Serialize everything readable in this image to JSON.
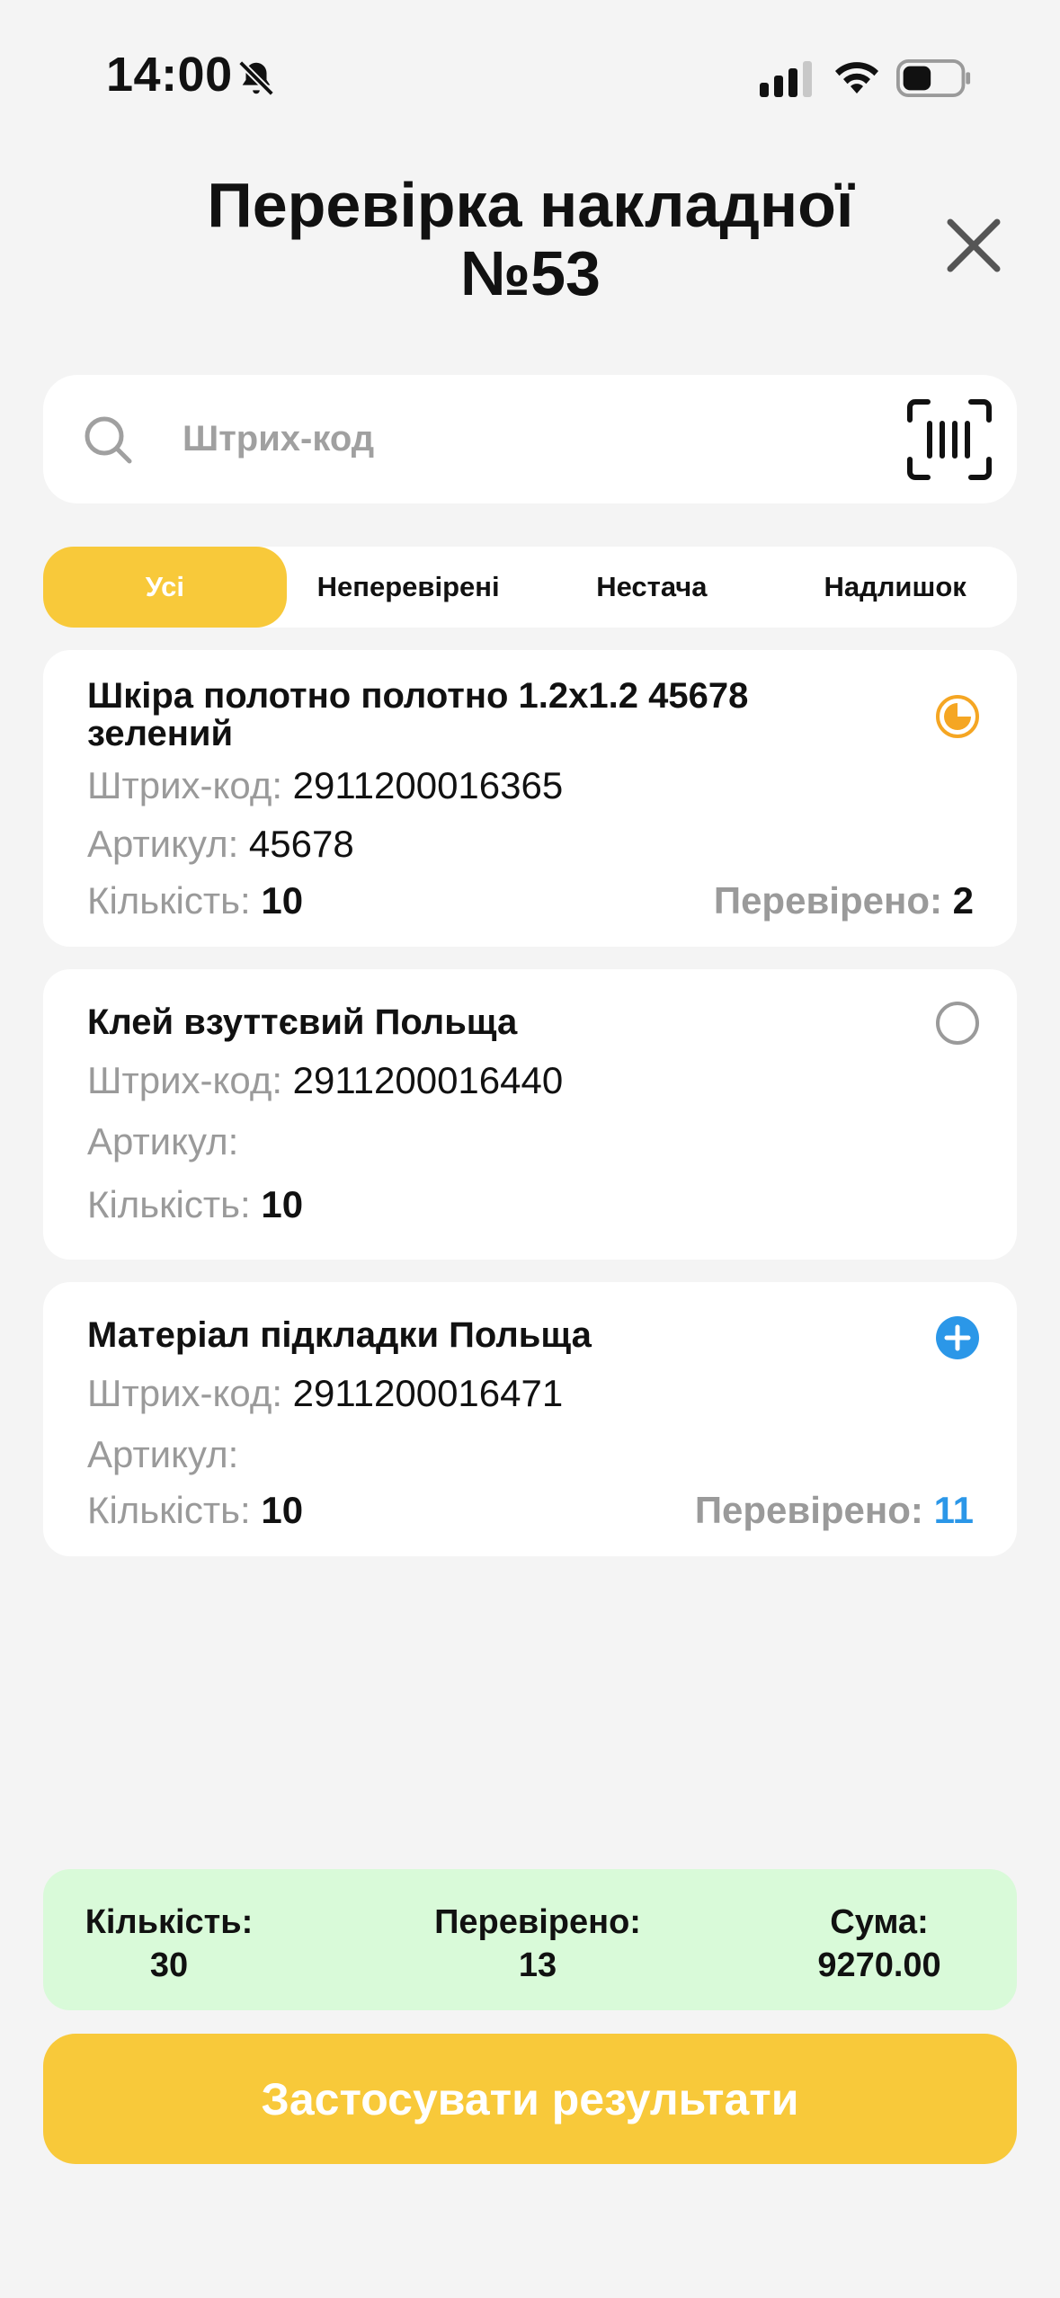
{
  "status_bar": {
    "time": "14:00"
  },
  "header": {
    "title": "Перевірка накладної №53"
  },
  "search": {
    "placeholder": "Штрих-код",
    "value": ""
  },
  "tabs": [
    {
      "label": "Усі",
      "active": true
    },
    {
      "label": "Неперевірені",
      "active": false
    },
    {
      "label": "Нестача",
      "active": false
    },
    {
      "label": "Надлишок",
      "active": false
    }
  ],
  "labels": {
    "barcode": "Штрих-код:",
    "article": "Артикул:",
    "quantity": "Кількість:",
    "checked": "Перевірено:"
  },
  "items": [
    {
      "name": "Шкіра полотно полотно 1.2x1.2 45678 зелений",
      "barcode": "2911200016365",
      "article": "45678",
      "quantity": "10",
      "checked": "2",
      "status": "partial",
      "status_icon": "partial-progress-icon",
      "status_color": "#f5a623"
    },
    {
      "name": "Клей взуттєвий Польща",
      "barcode": "2911200016440",
      "article": "",
      "quantity": "10",
      "checked": null,
      "status": "unchecked",
      "status_icon": "empty-circle-icon",
      "status_color": "#9a9a9a"
    },
    {
      "name": "Матеріал підкладки Польща",
      "barcode": "2911200016471",
      "article": "",
      "quantity": "10",
      "checked": "11",
      "status": "surplus",
      "status_icon": "plus-circle-icon",
      "status_color": "#2b97e8"
    }
  ],
  "summary": {
    "quantity_label": "Кількість:",
    "quantity_value": "30",
    "checked_label": "Перевірено:",
    "checked_value": "13",
    "sum_label": "Сума:",
    "sum_value": "9270.00"
  },
  "apply_button": {
    "label": "Застосувати результати"
  },
  "colors": {
    "accent": "#f8c93a",
    "summary_bg": "#d9fad9",
    "surplus": "#2b97e8",
    "partial": "#f5a623",
    "muted": "#9a9a9a"
  }
}
